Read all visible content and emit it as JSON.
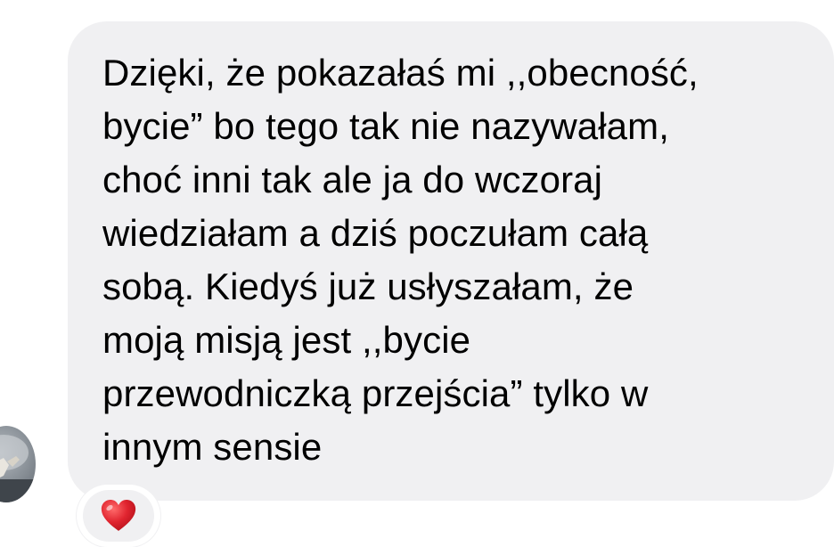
{
  "message": {
    "text": "Dzięki, że pokazałaś mi ,,obecność,\nbycie” bo tego tak nie nazywałam,\nchoć inni tak ale ja do wczoraj\nwiedziałam a dziś poczułam całą\nsobą. Kiedyś już usłyszałam, że\nmoją misją jest ,,bycie\nprzewodniczką przejścia” tylko w\ninnym sensie",
    "bubble_color": "#f0f0f2",
    "text_color": "#000000"
  },
  "reaction": {
    "icon": "red-heart-icon",
    "color": "#e0242f"
  },
  "sender": {
    "avatar": "avatar"
  }
}
